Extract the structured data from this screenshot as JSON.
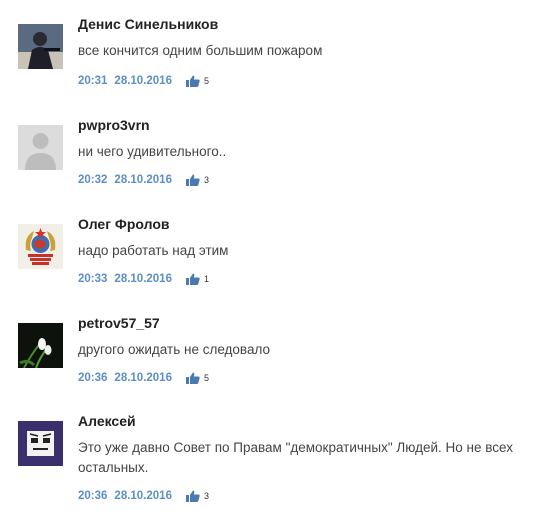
{
  "comments": [
    {
      "author": "Денис Синельников",
      "text": "все кончится одним большим пожаром",
      "time": "20:31",
      "date": "28.10.2016",
      "likes": "5",
      "avatar_icon": "photo-avatar-icon"
    },
    {
      "author": "pwpro3vrn",
      "text": "ни чего удивительного..",
      "time": "20:32",
      "date": "28.10.2016",
      "likes": "3",
      "avatar_icon": "default-user-icon"
    },
    {
      "author": "Олег Фролов",
      "text": "надо работать над этим",
      "time": "20:33",
      "date": "28.10.2016",
      "likes": "1",
      "avatar_icon": "ussr-emblem-icon"
    },
    {
      "author": "petrov57_57",
      "text": "другого ожидать не следовало",
      "time": "20:36",
      "date": "28.10.2016",
      "likes": "5",
      "avatar_icon": "snowdrop-flower-icon"
    },
    {
      "author": "Алексей",
      "text": "Это уже давно Совет по Правам \"демократичных\" Людей. Но не всех остальных.",
      "time": "20:36",
      "date": "28.10.2016",
      "likes": "3",
      "avatar_icon": "cartoon-face-icon"
    }
  ],
  "colors": {
    "meta": "#5b8fc7",
    "like": "#4a7ab0",
    "author": "#222222",
    "text": "#444444"
  }
}
